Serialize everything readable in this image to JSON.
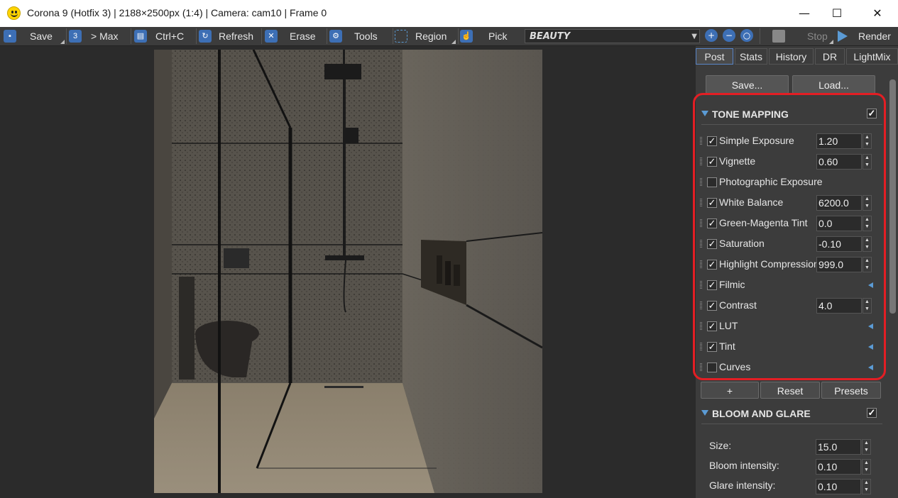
{
  "window": {
    "title": "Corona 9 (Hotfix 3) | 2188×2500px (1:4) | Camera: cam10 | Frame 0",
    "minimize": "—",
    "maximize": "☐",
    "close": "✕"
  },
  "toolbar": {
    "save": "Save",
    "to_max": "> Max",
    "ctrl_c": "Ctrl+C",
    "refresh": "Refresh",
    "erase": "Erase",
    "tools": "Tools",
    "region": "Region",
    "pick": "Pick",
    "pass_select": "BEAUTY",
    "stop": "Stop",
    "render": "Render"
  },
  "panel": {
    "tabs": [
      "Post",
      "Stats",
      "History",
      "DR",
      "LightMix"
    ],
    "active_tab": "Post",
    "save_btn": "Save...",
    "load_btn": "Load...",
    "tone_mapping": {
      "title": "TONE MAPPING",
      "enabled": true,
      "rows": [
        {
          "name": "Simple Exposure",
          "checked": true,
          "value": "1.20"
        },
        {
          "name": "Vignette",
          "checked": true,
          "value": "0.60"
        },
        {
          "name": "Photographic Exposure",
          "checked": false,
          "value": null
        },
        {
          "name": "White Balance",
          "checked": true,
          "value": "6200.0"
        },
        {
          "name": "Green-Magenta Tint",
          "checked": true,
          "value": "0.0"
        },
        {
          "name": "Saturation",
          "checked": true,
          "value": "-0.10"
        },
        {
          "name": "Highlight Compression",
          "checked": true,
          "value": "999.0"
        },
        {
          "name": "Filmic",
          "checked": true,
          "value": null
        },
        {
          "name": "Contrast",
          "checked": true,
          "value": "4.0"
        },
        {
          "name": "LUT",
          "checked": true,
          "value": null
        },
        {
          "name": "Tint",
          "checked": true,
          "value": null
        },
        {
          "name": "Curves",
          "checked": false,
          "value": null
        }
      ],
      "add_btn": "+",
      "reset_btn": "Reset",
      "presets_btn": "Presets"
    },
    "bloom_glare": {
      "title": "BLOOM AND GLARE",
      "enabled": true,
      "rows": [
        {
          "name": "Size:",
          "value": "15.0"
        },
        {
          "name": "Bloom intensity:",
          "value": "0.10"
        },
        {
          "name": "Glare intensity:",
          "value": "0.10"
        }
      ]
    }
  },
  "colors": {
    "accent": "#5b9bd5",
    "highlight_outline": "#e31e24",
    "panel_bg": "#3c3c3c"
  }
}
